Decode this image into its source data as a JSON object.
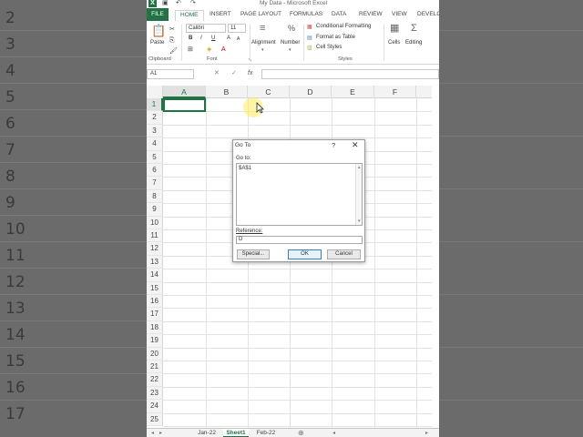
{
  "window": {
    "title": "My Data - Microsoft Excel",
    "app_icon": "X"
  },
  "quick_access": {
    "save_icon": "save-icon",
    "undo_icon": "undo-icon",
    "redo_icon": "redo-icon"
  },
  "ribbon_tabs": [
    {
      "label": "FILE"
    },
    {
      "label": "HOME"
    },
    {
      "label": "INSERT"
    },
    {
      "label": "PAGE LAYOUT"
    },
    {
      "label": "FORMULAS"
    },
    {
      "label": "DATA"
    },
    {
      "label": "REVIEW"
    },
    {
      "label": "VIEW"
    },
    {
      "label": "DEVELO"
    }
  ],
  "ribbon": {
    "clipboard": {
      "paste_label": "Paste",
      "group_label": "Clipboard"
    },
    "font": {
      "font_name": "Calibri",
      "font_size": "11",
      "bold": "B",
      "italic": "I",
      "underline": "U",
      "grow": "A",
      "shrink": "A",
      "group_label": "Font"
    },
    "alignment": {
      "label": "Alignment"
    },
    "number": {
      "label": "Number",
      "icon": "%"
    },
    "styles": {
      "conditional": "Conditional Formatting",
      "format_table": "Format as Table",
      "cell_styles": "Cell Styles",
      "group_label": "Styles"
    },
    "cells": {
      "label": "Cells"
    },
    "editing": {
      "label": "Editing"
    }
  },
  "formula_bar": {
    "name_box": "A1",
    "cancel": "✕",
    "enter": "✓",
    "fx": "fx",
    "value": ""
  },
  "columns": [
    "A",
    "B",
    "C",
    "D",
    "E",
    "F"
  ],
  "rows": [
    "1",
    "2",
    "3",
    "4",
    "5",
    "6",
    "7",
    "8",
    "9",
    "10",
    "11",
    "12",
    "13",
    "14",
    "15",
    "16",
    "17",
    "18",
    "19",
    "20",
    "21",
    "22",
    "23",
    "24",
    "25"
  ],
  "background_rows": [
    "2",
    "3",
    "4",
    "5",
    "6",
    "7",
    "8",
    "9",
    "10",
    "11",
    "12",
    "13",
    "14",
    "15",
    "16",
    "17"
  ],
  "sheet_tabs": [
    {
      "label": "Jan-22"
    },
    {
      "label": "Sheet1"
    },
    {
      "label": "Feb-22"
    }
  ],
  "sheet_add": "⊕",
  "dialog": {
    "title": "Go To",
    "help": "?",
    "close": "✕",
    "goto_label": "Go to:",
    "list_items": [
      "$A$1"
    ],
    "reference_label": "Reference:",
    "reference_value": "D",
    "special_button": "Special...",
    "ok_button": "OK",
    "cancel_button": "Cancel"
  }
}
